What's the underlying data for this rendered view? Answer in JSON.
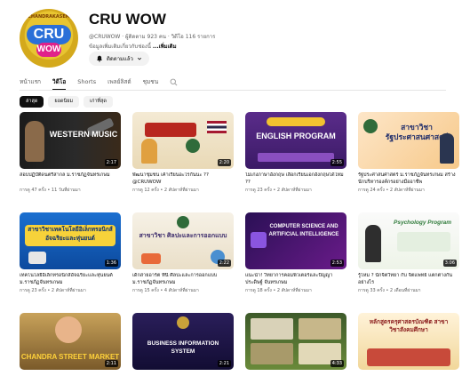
{
  "channel": {
    "avatar_ring_text": "CHANDRAKASEM",
    "avatar_logo_top": "CRU",
    "avatar_logo_bottom": "WOW",
    "name": "CRU WOW",
    "handle_meta": "@CRUWOW · ผู้ติดตาม 923 คน · วิดีโอ 116 รายการ",
    "description": "ข้อมูลเพิ่มเติมเกี่ยวกับช่องนี้ ",
    "description_more": "...เพิ่มเติม",
    "subscribe_label": "ติดตามแล้ว"
  },
  "tabs": [
    {
      "label": "หน้าแรก",
      "active": false
    },
    {
      "label": "วิดีโอ",
      "active": true
    },
    {
      "label": "Shorts",
      "active": false
    },
    {
      "label": "เพลย์ลิสต์",
      "active": false
    },
    {
      "label": "ชุมชน",
      "active": false
    }
  ],
  "chips": [
    {
      "label": "ล่าสุด",
      "active": true
    },
    {
      "label": "ยอดนิยม",
      "active": false
    },
    {
      "label": "เก่าที่สุด",
      "active": false
    }
  ],
  "videos": [
    {
      "thumb_text": "WESTERN MUSIC",
      "duration": "2:17",
      "title": "สอบปฏิบัติดนตรีสากล ม.ราชภัฏจันทรเกษม",
      "stats": "การดู 47 ครั้ง • 11 วันที่ผ่านมา"
    },
    {
      "thumb_text": "",
      "duration": "2:20",
      "title": "พัฒนาชุมชน เค้าเรียนอะไรกันนะ ?? @CRUWOW",
      "stats": "การดู 12 ครั้ง • 2 สัปดาห์ที่ผ่านมา"
    },
    {
      "thumb_text": "ENGLISH PROGRAM",
      "duration": "2:55",
      "title": "ไม่เก่งภาษาอังกฤษ เลือกเรียนเอกอังกฤษได้ไหม ??",
      "stats": "การดู 23 ครั้ง • 2 สัปดาห์ที่ผ่านมา"
    },
    {
      "thumb_text": "สาขาวิชา รัฐประศาสนศาสตร์",
      "duration": "",
      "title": "รัฐประศาสนศาสตร์ ม.ราชภัฏจันทรเกษม สร้างนักบริหารองค์กรอย่างมืออาชีพ",
      "stats": "การดู 24 ครั้ง • 2 สัปดาห์ที่ผ่านมา"
    },
    {
      "thumb_text": "สาขาวิชาเทคโนโลยีอิเล็กทรอนิกส์ อัจฉริยะและหุ่นยนต์",
      "duration": "1:36",
      "title": "เทคโนโลยีอิเล็กทรอนิกส์อัจฉริยะและหุ่นยนต์ ม.ราชภัฏจันทรเกษม",
      "stats": "การดู 23 ครั้ง • 2 สัปดาห์ที่ผ่านมา"
    },
    {
      "thumb_text": "สาขาวิชา ศิลปะและการออกแบบ",
      "duration": "2:22",
      "title": "เด็กสายอาร์ต ที่นี่ ศิลปะและการออกแบบ ม.ราชภัฏจันทรเกษม",
      "stats": "การดู 15 ครั้ง • 4 สัปดาห์ที่ผ่านมา"
    },
    {
      "thumb_text": "COMPUTER SCIENCE AND ARTIFICIAL INTELLIGENCE",
      "duration": "2:53",
      "title": "แนะนำ! วิทยาการคอมพิวเตอร์และปัญญาประดิษฐ์ จันทรเกษม",
      "stats": "การดู 18 ครั้ง • 2 สัปดาห์ที่ผ่านมา"
    },
    {
      "thumb_text": "Psychology Program",
      "duration": "3:06",
      "title": "รู้ไหม ? นักจิตวิทยา กับ จิตแพทย์ แตกต่างกันอย่างไร",
      "stats": "การดู 33 ครั้ง • 2 เดือนที่ผ่านมา"
    },
    {
      "thumb_text": "CHANDRA STREET MARKET",
      "duration": "2:11",
      "title": "",
      "stats": ""
    },
    {
      "thumb_text": "BUSINESS INFORMATION SYSTEM",
      "duration": "2:21",
      "title": "",
      "stats": ""
    },
    {
      "thumb_text": "",
      "duration": "4:33",
      "title": "",
      "stats": ""
    },
    {
      "thumb_text": "หลักสูตรครุศาสตรบัณฑิต สาขาวิชาสังคมศึกษา",
      "duration": "",
      "title": "",
      "stats": ""
    }
  ]
}
